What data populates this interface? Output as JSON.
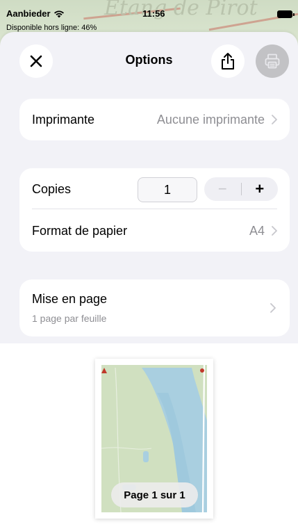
{
  "status_bar": {
    "carrier": "Aanbieder",
    "time": "11:56",
    "offline_text": "Disponible hors ligne: 46%"
  },
  "background_map": {
    "watermark": "Etang de Pirot"
  },
  "header": {
    "title": "Options",
    "close_icon": "close-icon",
    "share_icon": "share-icon",
    "print_icon": "printer-icon"
  },
  "printer": {
    "label": "Imprimante",
    "value": "Aucune imprimante"
  },
  "copies": {
    "label": "Copies",
    "value": "1",
    "minus": "−",
    "plus": "+"
  },
  "paper": {
    "label": "Format de papier",
    "value": "A4"
  },
  "layout": {
    "title": "Mise en page",
    "subtitle": "1 page par feuille"
  },
  "preview": {
    "badge": "Page 1 sur 1"
  },
  "colors": {
    "sheet_bg": "#f2f2f7",
    "card_bg": "#ffffff",
    "secondary_text": "#8e8e93",
    "disabled_button": "#c2c2c5"
  }
}
